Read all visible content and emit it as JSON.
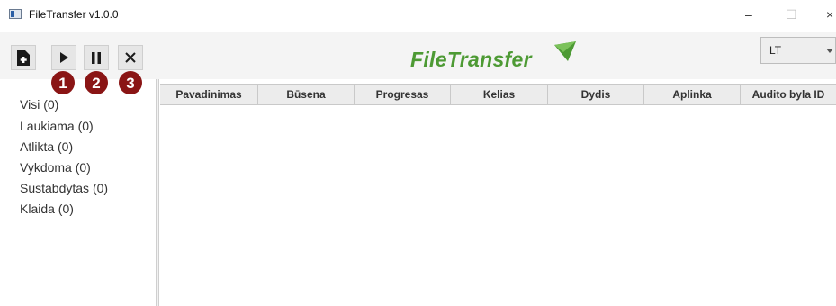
{
  "window": {
    "title": "FileTransfer v1.0.0",
    "controls": {
      "minimize": "–",
      "maximize": "☐",
      "close": "×"
    }
  },
  "toolbar": {
    "buttons": [
      {
        "icon": "add-file-icon",
        "badge": ""
      },
      {
        "icon": "play-icon",
        "badge": "1"
      },
      {
        "icon": "pause-icon",
        "badge": "2"
      },
      {
        "icon": "close-icon",
        "badge": "3"
      }
    ],
    "logo_text": "FileTransfer",
    "language": "LT"
  },
  "sidebar": {
    "items": [
      {
        "label": "Visi (0)"
      },
      {
        "label": "Laukiama (0)"
      },
      {
        "label": "Atlikta (0)"
      },
      {
        "label": "Vykdoma (0)"
      },
      {
        "label": "Sustabdytas (0)"
      },
      {
        "label": "Klaida (0)"
      }
    ]
  },
  "table": {
    "columns": [
      "Pavadinimas",
      "Būsena",
      "Progresas",
      "Kelias",
      "Dydis",
      "Aplinka",
      "Audito byla ID"
    ],
    "rows": []
  },
  "colors": {
    "badge": "#8a1515",
    "logo": "#4d9a34"
  }
}
